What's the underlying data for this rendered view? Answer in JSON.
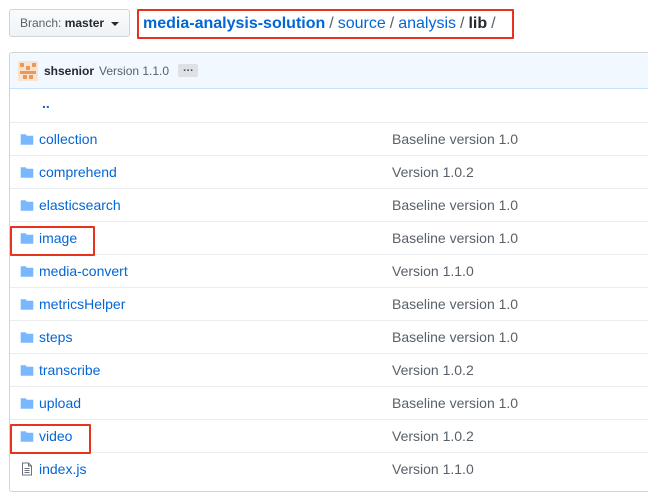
{
  "branch": {
    "prefix": "Branch:",
    "name": "master"
  },
  "breadcrumb": {
    "repo": "media-analysis-solution",
    "sep": "/",
    "parts": [
      "source",
      "analysis"
    ],
    "current": "lib",
    "trailing": "/"
  },
  "commit": {
    "author": "shsenior",
    "message": "Version 1.1.0",
    "ellipsis": "…"
  },
  "parent_dir": "..",
  "files": [
    {
      "name": "collection",
      "type": "folder",
      "message": "Baseline version 1.0"
    },
    {
      "name": "comprehend",
      "type": "folder",
      "message": "Version 1.0.2"
    },
    {
      "name": "elasticsearch",
      "type": "folder",
      "message": "Baseline version 1.0"
    },
    {
      "name": "image",
      "type": "folder",
      "message": "Baseline version 1.0"
    },
    {
      "name": "media-convert",
      "type": "folder",
      "message": "Version 1.1.0"
    },
    {
      "name": "metricsHelper",
      "type": "folder",
      "message": "Baseline version 1.0"
    },
    {
      "name": "steps",
      "type": "folder",
      "message": "Baseline version 1.0"
    },
    {
      "name": "transcribe",
      "type": "folder",
      "message": "Version 1.0.2"
    },
    {
      "name": "upload",
      "type": "folder",
      "message": "Baseline version 1.0"
    },
    {
      "name": "video",
      "type": "folder",
      "message": "Version 1.0.2"
    },
    {
      "name": "index.js",
      "type": "file",
      "message": "Version 1.1.0"
    }
  ],
  "colors": {
    "highlight": "#e8321e",
    "link": "#0366d6",
    "folder": "#79b8ff"
  }
}
